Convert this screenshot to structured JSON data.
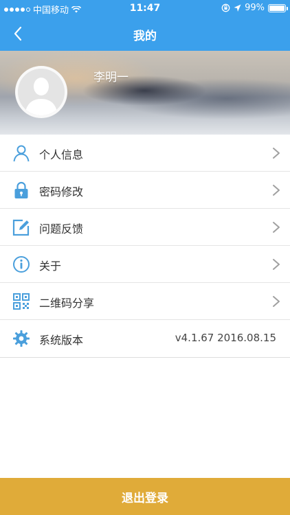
{
  "status_bar": {
    "carrier": "中国移动",
    "time": "11:47",
    "battery": "99%",
    "signal_bars_filled": 4,
    "signal_bars_total": 5
  },
  "nav": {
    "title": "我的",
    "back_icon": "chevron-left-icon"
  },
  "profile": {
    "name": "李明一",
    "avatar_icon": "default-avatar-icon"
  },
  "menu": {
    "items": [
      {
        "label": "个人信息",
        "icon": "person-icon"
      },
      {
        "label": "密码修改",
        "icon": "lock-icon"
      },
      {
        "label": "问题反馈",
        "icon": "edit-icon"
      },
      {
        "label": "关于",
        "icon": "info-icon"
      },
      {
        "label": "二维码分享",
        "icon": "qrcode-icon"
      },
      {
        "label": "系统版本",
        "icon": "gear-icon",
        "value": "v4.1.67 2016.08.15"
      }
    ]
  },
  "logout": {
    "label": "退出登录"
  },
  "colors": {
    "header_blue": "#3ba0ec",
    "icon_blue": "#4a9fdc",
    "logout_yellow": "#e0ab39"
  }
}
